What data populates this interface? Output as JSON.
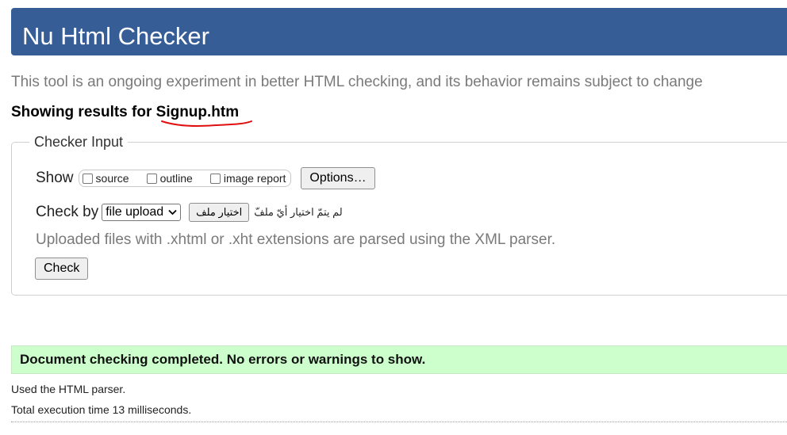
{
  "header": {
    "title": "Nu Html Checker"
  },
  "intro": "This tool is an ongoing experiment in better HTML checking, and its behavior remains subject to change",
  "results": {
    "prefix": "Showing results for",
    "filename": "Signup.htm"
  },
  "checker_input": {
    "legend": "Checker Input",
    "show_label": "Show",
    "show_options": [
      {
        "label": "source",
        "checked": false
      },
      {
        "label": "outline",
        "checked": false
      },
      {
        "label": "image report",
        "checked": false
      }
    ],
    "options_button": "Options…",
    "check_by_label": "Check by",
    "check_by_selected": "file upload",
    "file_button": "اختيار ملف",
    "no_file_text": "لم يتمّ اختيار أيّ ملفّ",
    "note": "Uploaded files with .xhtml or .xht extensions are parsed using the XML parser.",
    "check_button": "Check"
  },
  "status": {
    "message": "Document checking completed. No errors or warnings to show.",
    "color": "#ccffcc"
  },
  "meta": {
    "parser": "Used the HTML parser.",
    "time": "Total execution time 13 milliseconds."
  },
  "colors": {
    "header_bg": "#365d95",
    "annotation_underline": "#e01010"
  }
}
